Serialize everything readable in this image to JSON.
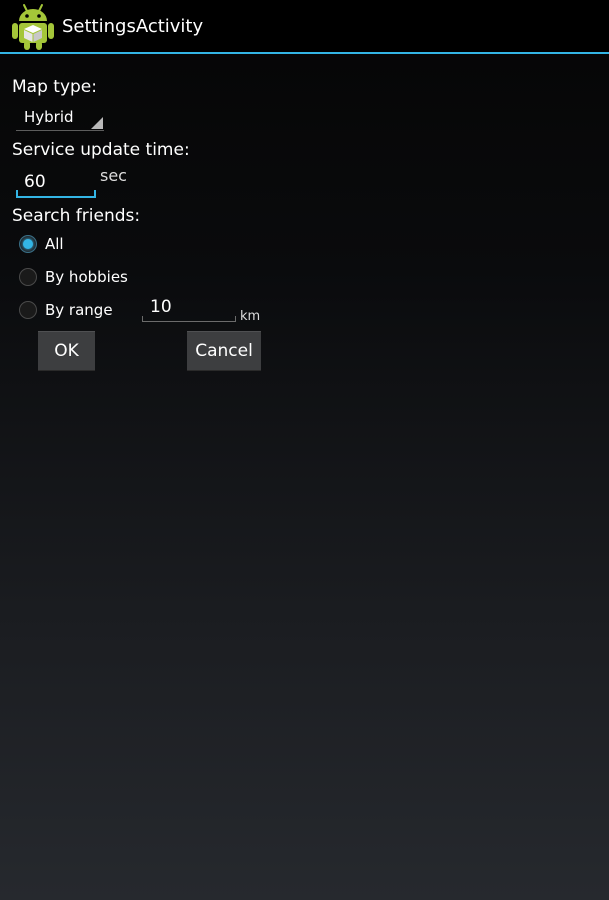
{
  "app": {
    "title": "SettingsActivity",
    "icon": "android-robot-icon",
    "accent_color": "#33b5e5"
  },
  "map_type": {
    "label": "Map type:",
    "selected": "Hybrid"
  },
  "service_update": {
    "label": "Service update time:",
    "value": "60",
    "unit": "sec"
  },
  "search_friends": {
    "label": "Search friends:",
    "options": [
      {
        "label": "All",
        "checked": true
      },
      {
        "label": "By hobbies",
        "checked": false
      },
      {
        "label": "By range",
        "checked": false
      }
    ],
    "range_value": "10",
    "range_unit": "km"
  },
  "buttons": {
    "ok": "OK",
    "cancel": "Cancel"
  }
}
